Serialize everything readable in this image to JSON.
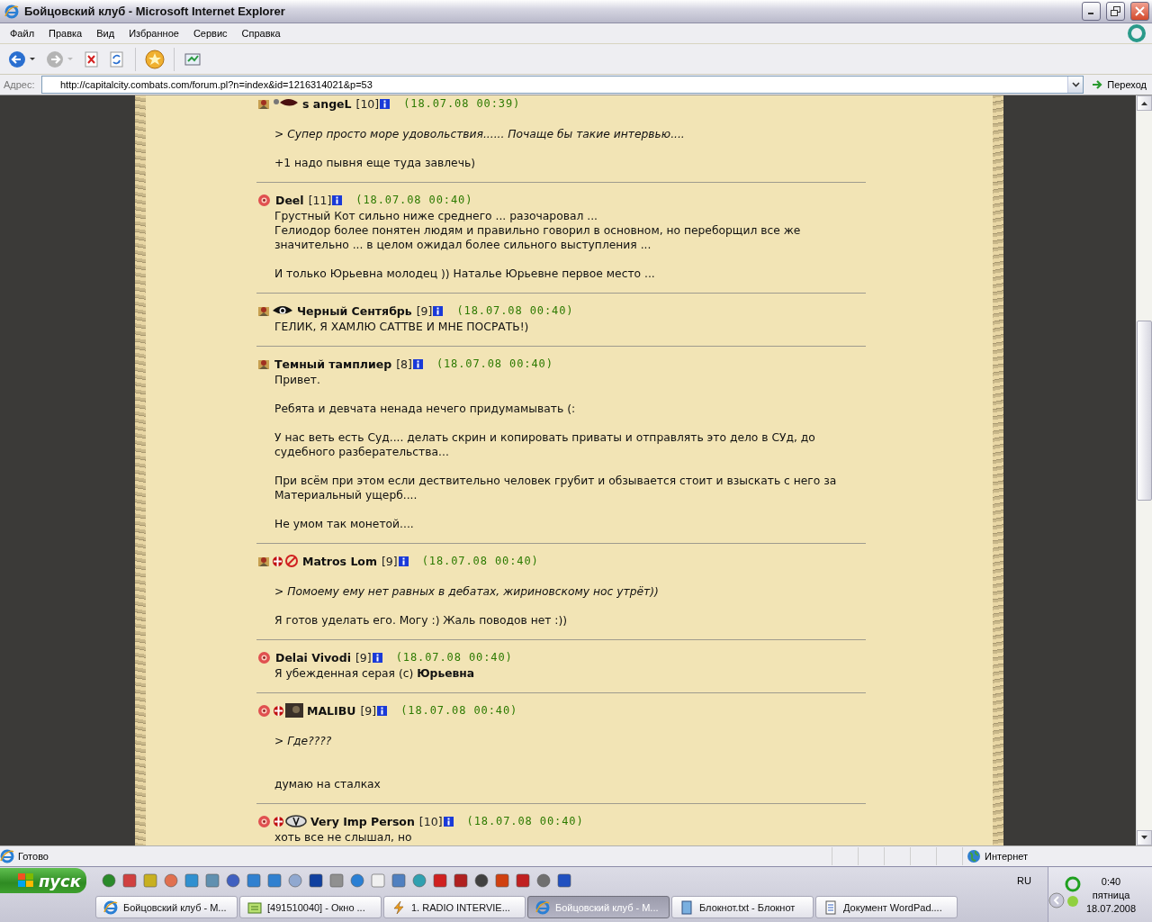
{
  "window": {
    "title": "Бойцовский клуб - Microsoft Internet Explorer"
  },
  "menu": [
    "Файл",
    "Правка",
    "Вид",
    "Избранное",
    "Сервис",
    "Справка"
  ],
  "toolbar": [
    {
      "kind": "back",
      "disabled": false
    },
    {
      "kind": "forward",
      "disabled": true
    },
    {
      "kind": "stop"
    },
    {
      "kind": "refresh"
    },
    {
      "kind": "favorites"
    },
    {
      "kind": "media"
    }
  ],
  "address": {
    "label": "Адрес:",
    "value": "http://capitalcity.combats.com/forum.pl?n=index&id=1216314021&p=53",
    "go": "Переход"
  },
  "posts": [
    {
      "name": "s angeL",
      "level": "[10]",
      "time": "(18.07.08 00:39)",
      "body": [
        {
          "kind": "blank"
        },
        {
          "kind": "quote",
          "text": "> Супер просто   море удовольствия...... Почаще бы такие интервью...."
        },
        {
          "kind": "blank"
        },
        {
          "kind": "text",
          "text": "+1 надо пывня еще туда завлечь)"
        }
      ]
    },
    {
      "name": "Deel",
      "level": "[11]",
      "time": "(18.07.08 00:40)",
      "body": [
        {
          "kind": "text",
          "text": "Грустный Кот сильно ниже среднего ... разочаровал ..."
        },
        {
          "kind": "text",
          "text": "Гелиодор более понятен людям и правильно говорил в основном, но переборщил все же значительно ... в целом ожидал более сильного выступления ..."
        },
        {
          "kind": "blank"
        },
        {
          "kind": "text",
          "text": "И только Юрьевна молодец )) Наталье Юрьевне первое место ..."
        }
      ]
    },
    {
      "name": "Черный Сентябрь",
      "level": "[9]",
      "time": "(18.07.08 00:40)",
      "body": [
        {
          "kind": "text",
          "text": "ГЕЛИК, Я ХАМЛЮ САТТВЕ И МНЕ ПОСРАТЬ!)"
        }
      ]
    },
    {
      "name": "Темный тамплиер",
      "level": "[8]",
      "time": "(18.07.08 00:40)",
      "body": [
        {
          "kind": "text",
          "text": "Привет."
        },
        {
          "kind": "blank"
        },
        {
          "kind": "text",
          "text": "Ребята и девчата ненада нечего придумамывать (:"
        },
        {
          "kind": "blank"
        },
        {
          "kind": "text",
          "text": "У нас веть есть Суд.... делать скрин и копировать приваты и отправлять это дело в СУд, до судебного разберательства..."
        },
        {
          "kind": "blank"
        },
        {
          "kind": "text",
          "text": "При всём при этом если дествительно человек грубит и обзывается стоит и взыскать с него за Материальный ущерб...."
        },
        {
          "kind": "blank"
        },
        {
          "kind": "text",
          "text": "Не умом так монетой...."
        }
      ]
    },
    {
      "name": "Matros Lom",
      "level": "[9]",
      "time": "(18.07.08 00:40)",
      "body": [
        {
          "kind": "blank"
        },
        {
          "kind": "quote",
          "text": "> Помоему ему нет равных в дебатах, жириновскому нос утрёт))"
        },
        {
          "kind": "blank"
        },
        {
          "kind": "text",
          "text": "Я готов уделать его. Могу :) Жаль поводов нет :))"
        }
      ]
    },
    {
      "name": "Delai Vivodi",
      "level": "[9]",
      "time": "(18.07.08 00:40)",
      "body": [
        {
          "kind": "text",
          "text": "Я убежденная серая (с) **Юрьевна**"
        }
      ]
    },
    {
      "name": "MALIBU",
      "level": "[9]",
      "time": "(18.07.08 00:40)",
      "body": [
        {
          "kind": "blank"
        },
        {
          "kind": "quote",
          "text": "> Где????"
        },
        {
          "kind": "blank"
        },
        {
          "kind": "blank"
        },
        {
          "kind": "text",
          "text": "думаю на сталках"
        }
      ]
    },
    {
      "name": "Very Imp Person",
      "level": "[10]",
      "time": "(18.07.08 00:40)",
      "body": [
        {
          "kind": "text",
          "text": "хоть все не слышал, но"
        }
      ]
    }
  ],
  "status_bar": {
    "text": "Готово",
    "zone": "Интернет"
  },
  "taskbar": {
    "start": "пуск",
    "language": "RU",
    "tasks": [
      {
        "label": "Бойцовский клуб - М...",
        "selected": false
      },
      {
        "label": "[491510040] - Окно ...",
        "selected": false
      },
      {
        "label": "1. RADIO INTERVIE...",
        "selected": false
      },
      {
        "label": "Бойцовский клуб - М...",
        "selected": true
      },
      {
        "label": "Блокнот.txt - Блокнот",
        "selected": false
      },
      {
        "label": "Документ WordPad....",
        "selected": false
      }
    ],
    "clock": {
      "time": "0:40",
      "day": "пятница",
      "date": "18.07.2008"
    }
  }
}
